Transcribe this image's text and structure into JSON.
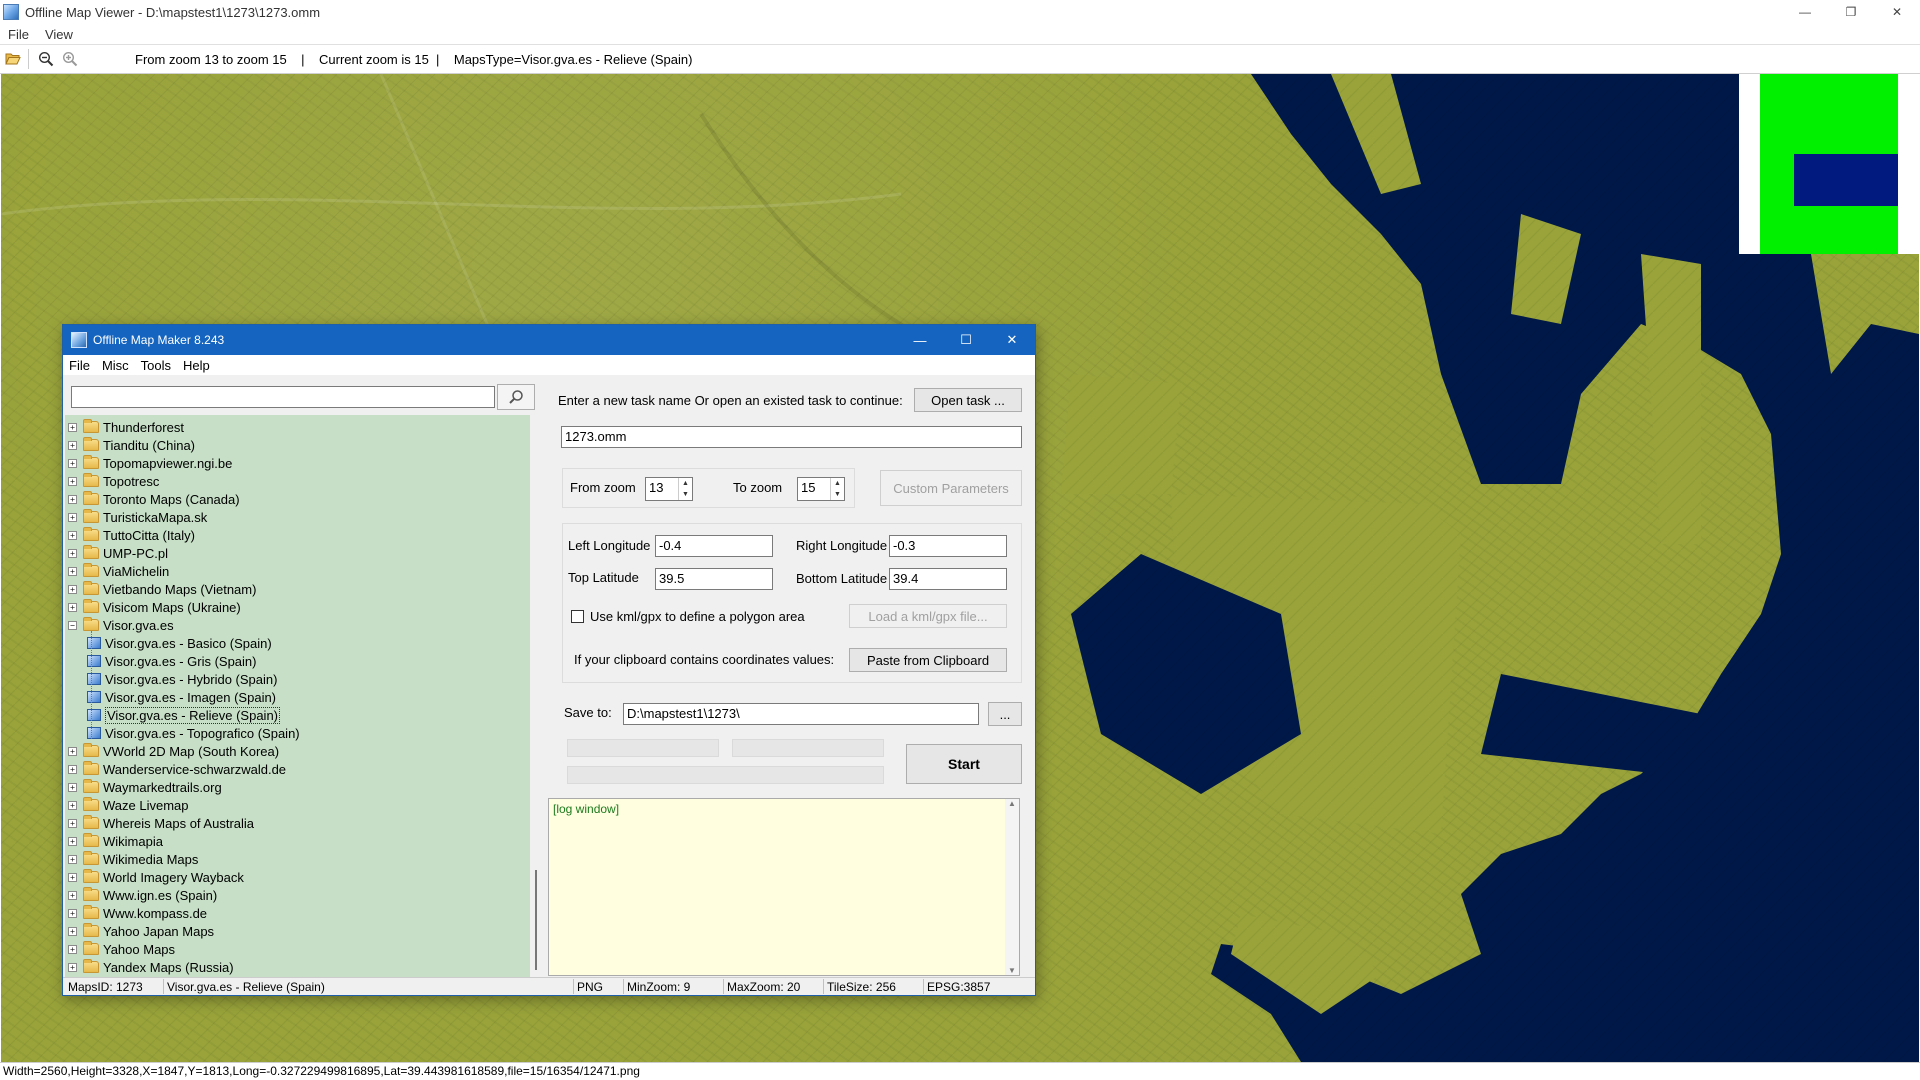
{
  "viewer": {
    "title": "Offline Map Viewer - D:\\mapstest1\\1273\\1273.omm",
    "menu": [
      "File",
      "View"
    ],
    "toolbar_info": "From zoom 13 to zoom 15    |    Current zoom is 15  |    MapsType=Visor.gva.es - Relieve (Spain)",
    "status": "Width=2560,Height=3328,X=1847,Y=1813,Long=-0.327229499816895,Lat=39.443981618589,file=15/16354/12471.png",
    "icons": [
      "folder-open-icon",
      "zoom-out-icon",
      "zoom-in-icon"
    ]
  },
  "maker": {
    "title": "Offline Map Maker 8.243",
    "menu": [
      "File",
      "Misc",
      "Tools",
      "Help"
    ],
    "search_value": "",
    "tree": [
      {
        "label": "Thunderforest",
        "kind": "folder"
      },
      {
        "label": "Tianditu (China)",
        "kind": "folder"
      },
      {
        "label": "Topomapviewer.ngi.be",
        "kind": "folder"
      },
      {
        "label": "Topotresc",
        "kind": "folder"
      },
      {
        "label": "Toronto Maps (Canada)",
        "kind": "folder"
      },
      {
        "label": "TuristickaMapa.sk",
        "kind": "folder"
      },
      {
        "label": "TuttoCitta (Italy)",
        "kind": "folder"
      },
      {
        "label": "UMP-PC.pl",
        "kind": "folder"
      },
      {
        "label": "ViaMichelin",
        "kind": "folder"
      },
      {
        "label": "Vietbando Maps (Vietnam)",
        "kind": "folder"
      },
      {
        "label": "Visicom Maps (Ukraine)",
        "kind": "folder"
      },
      {
        "label": "Visor.gva.es",
        "kind": "folder-open"
      },
      {
        "label": "Visor.gva.es - Basico (Spain)",
        "kind": "map"
      },
      {
        "label": "Visor.gva.es - Gris (Spain)",
        "kind": "map"
      },
      {
        "label": "Visor.gva.es - Hybrido (Spain)",
        "kind": "map"
      },
      {
        "label": "Visor.gva.es - Imagen (Spain)",
        "kind": "map"
      },
      {
        "label": "Visor.gva.es - Relieve (Spain)",
        "kind": "map",
        "selected": true
      },
      {
        "label": "Visor.gva.es - Topografico (Spain)",
        "kind": "map"
      },
      {
        "label": "VWorld 2D Map (South Korea)",
        "kind": "folder"
      },
      {
        "label": "Wanderservice-schwarzwald.de",
        "kind": "folder"
      },
      {
        "label": "Waymarkedtrails.org",
        "kind": "folder"
      },
      {
        "label": "Waze Livemap",
        "kind": "folder"
      },
      {
        "label": "Whereis Maps of Australia",
        "kind": "folder"
      },
      {
        "label": "Wikimapia",
        "kind": "folder"
      },
      {
        "label": "Wikimedia Maps",
        "kind": "folder"
      },
      {
        "label": "World Imagery Wayback",
        "kind": "folder"
      },
      {
        "label": "Www.ign.es (Spain)",
        "kind": "folder"
      },
      {
        "label": "Www.kompass.de",
        "kind": "folder"
      },
      {
        "label": "Yahoo Japan Maps",
        "kind": "folder"
      },
      {
        "label": "Yahoo Maps",
        "kind": "folder"
      },
      {
        "label": "Yandex Maps (Russia)",
        "kind": "folder"
      }
    ],
    "task_prompt": "Enter a new task name Or open an existed task to continue:",
    "open_task_label": "Open task ...",
    "task_name": "1273.omm",
    "from_zoom_label": "From zoom",
    "from_zoom": "13",
    "to_zoom_label": "To zoom",
    "to_zoom": "15",
    "custom_params_label": "Custom Parameters",
    "left_lon_label": "Left Longitude",
    "left_lon": "-0.4",
    "right_lon_label": "Right Longitude",
    "right_lon": "-0.3",
    "top_lat_label": "Top Latitude",
    "top_lat": "39.5",
    "bottom_lat_label": "Bottom Latitude",
    "bottom_lat": "39.4",
    "kml_label": "Use kml/gpx to define a polygon area",
    "kml_checked": false,
    "load_kml_label": "Load a kml/gpx file...",
    "clipboard_label": "If your clipboard contains coordinates values:",
    "paste_label": "Paste from Clipboard",
    "save_to_label": "Save to:",
    "save_to": "D:\\mapstest1\\1273\\",
    "browse_label": "...",
    "start_label": "Start",
    "log_text": "[log window]",
    "status": {
      "maps_id": "MapsID: 1273",
      "map_name": "Visor.gva.es - Relieve (Spain)",
      "format": "PNG",
      "min_zoom": "MinZoom: 9",
      "max_zoom": "MaxZoom: 20",
      "tile_size": "TileSize: 256",
      "epsg": "EPSG:3857"
    }
  },
  "colors": {
    "map_land": "#99a33a",
    "map_water": "#001848",
    "dialog_title": "#1565c0",
    "tree_bg": "#c6dfc6",
    "log_bg": "#ffffe0",
    "minimap_green": "#00f000",
    "minimap_blue": "#001a80"
  }
}
